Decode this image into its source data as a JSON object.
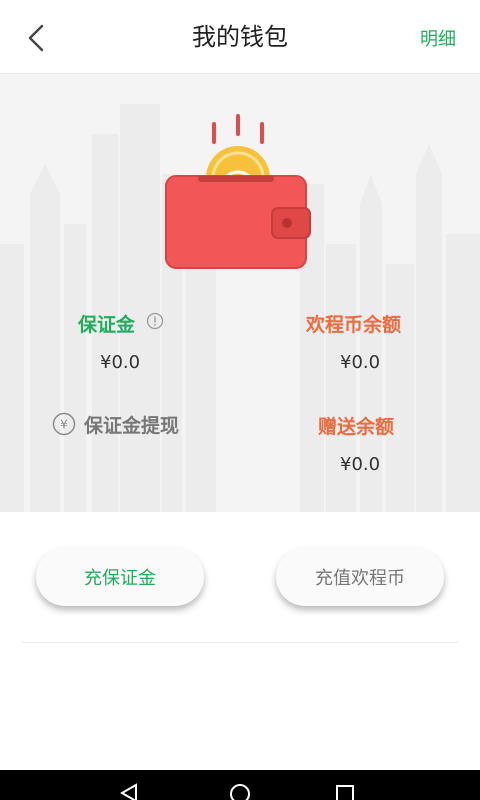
{
  "header": {
    "title": "我的钱包",
    "detail_label": "明细"
  },
  "wallet": {
    "deposit": {
      "label": "保证金",
      "value": "¥0.0"
    },
    "coin_balance": {
      "label": "欢程币余额",
      "value": "¥0.0"
    },
    "withdraw": {
      "label": "保证金提现"
    },
    "gift_balance": {
      "label": "赠送余额",
      "value": "¥0.0"
    }
  },
  "actions": {
    "recharge_deposit": "充保证金",
    "recharge_coin": "充值欢程币"
  },
  "colors": {
    "accent_green": "#1fae5b",
    "accent_orange": "#ee6a3f",
    "wallet_red": "#f25656",
    "coin_gold": "#f7c23a"
  },
  "icons": {
    "back": "chevron-left-icon",
    "info": "info-icon",
    "yuan": "yuan-circle-icon",
    "wallet": "wallet-illustration",
    "nav_back": "nav-back-icon",
    "nav_home": "nav-home-icon",
    "nav_recent": "nav-recent-icon"
  }
}
